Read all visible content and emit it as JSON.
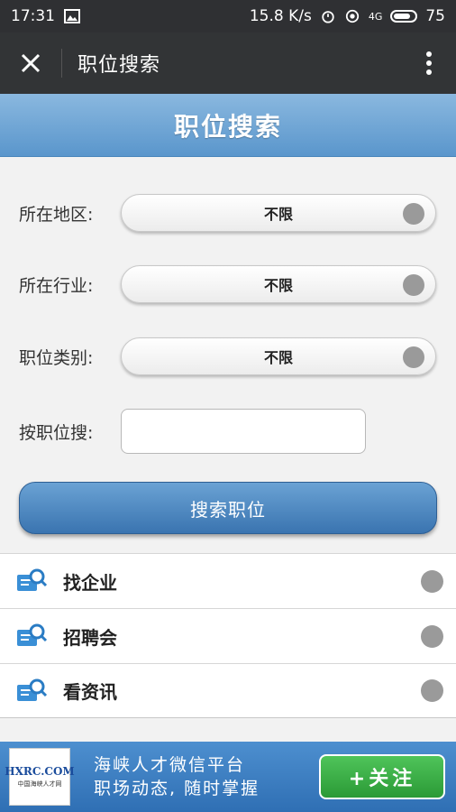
{
  "status_bar": {
    "time": "17:31",
    "net_speed": "15.8 K/s",
    "network": "4G",
    "battery": "75"
  },
  "nav": {
    "title": "职位搜索"
  },
  "header": {
    "title": "职位搜索"
  },
  "form": {
    "region": {
      "label": "所在地区:",
      "value": "不限"
    },
    "industry": {
      "label": "所在行业:",
      "value": "不限"
    },
    "category": {
      "label": "职位类别:",
      "value": "不限"
    },
    "keyword": {
      "label": "按职位搜:",
      "value": ""
    },
    "search_button": "搜索职位"
  },
  "links": [
    {
      "label": "找企业",
      "icon": "search-doc-icon"
    },
    {
      "label": "招聘会",
      "icon": "search-doc-icon"
    },
    {
      "label": "看资讯",
      "icon": "search-doc-icon"
    }
  ],
  "banner": {
    "logo_main": "HXRC.COM",
    "logo_sub": "中国海峡人才网",
    "line1": "海峡人才微信平台",
    "line2": "职场动态, 随时掌握",
    "follow_button": "+关注"
  },
  "colors": {
    "header_blue": "#5a96cc",
    "follow_green": "#2b9a36",
    "nav_dark": "#323436"
  }
}
